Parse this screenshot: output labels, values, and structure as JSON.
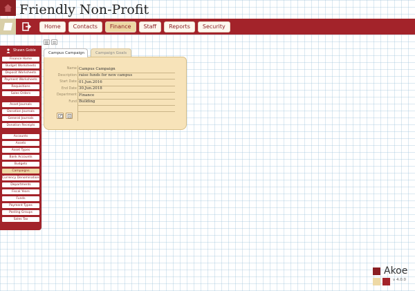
{
  "app": {
    "title": "Friendly Non-Profit"
  },
  "nav": [
    {
      "label": "Home",
      "active": false
    },
    {
      "label": "Contacts",
      "active": false
    },
    {
      "label": "Finance",
      "active": true
    },
    {
      "label": "Staff",
      "active": false
    },
    {
      "label": "Reports",
      "active": false
    },
    {
      "label": "Security",
      "active": false
    }
  ],
  "sidebar": {
    "user": "Shawn Goble",
    "items": [
      {
        "label": "Finance Home",
        "active": false
      },
      {
        "label": "Budget Worksheets",
        "active": false
      },
      {
        "label": "Deposit Worksheets",
        "active": false
      },
      {
        "label": "Payment Worksheets",
        "active": false
      },
      {
        "label": "Requisitions",
        "active": false
      },
      {
        "label": "Sales Orders",
        "active": false
      },
      {
        "label": "Asset Journals",
        "active": false
      },
      {
        "label": "Donation Journals",
        "active": false
      },
      {
        "label": "General Journals",
        "active": false
      },
      {
        "label": "Donation Receipts",
        "active": false
      },
      {
        "label": "Accounts",
        "active": false
      },
      {
        "label": "Assets",
        "active": false
      },
      {
        "label": "Asset Types",
        "active": false
      },
      {
        "label": "Bank Accounts",
        "active": false
      },
      {
        "label": "Budgets",
        "active": false
      },
      {
        "label": "Campaigns",
        "active": true
      },
      {
        "label": "Currency Denominations",
        "active": false
      },
      {
        "label": "Departments",
        "active": false
      },
      {
        "label": "Fiscal Years",
        "active": false
      },
      {
        "label": "Funds",
        "active": false
      },
      {
        "label": "Payment Types",
        "active": false
      },
      {
        "label": "Posting Groups",
        "active": false
      },
      {
        "label": "Sales Tax",
        "active": false
      }
    ]
  },
  "tabs": [
    {
      "label": "Campus Campaign",
      "active": true
    },
    {
      "label": "Campaign Goals",
      "active": false
    }
  ],
  "record": {
    "fields": [
      {
        "label": "Name",
        "value": "Campus Campaign"
      },
      {
        "label": "Description",
        "value": "raise funds for new campus"
      },
      {
        "label": "Start Date",
        "value": "01.Jun.2016"
      },
      {
        "label": "End Date",
        "value": "30.Jun.2018"
      },
      {
        "label": "Department",
        "value": "Finance"
      },
      {
        "label": "Fund",
        "value": "Building"
      }
    ]
  },
  "brand": {
    "name": "Akoe",
    "version": "v 4.0.0"
  },
  "colors": {
    "primary": "#a3232a",
    "accent": "#eed9a5",
    "panel": "#f7e3b9"
  },
  "icons": {
    "logo": "home-icon",
    "sidebar_toggle": "notebook-icon",
    "logout": "exit-icon",
    "user": "user-icon",
    "edit": "edit-icon",
    "delete": "delete-icon"
  }
}
